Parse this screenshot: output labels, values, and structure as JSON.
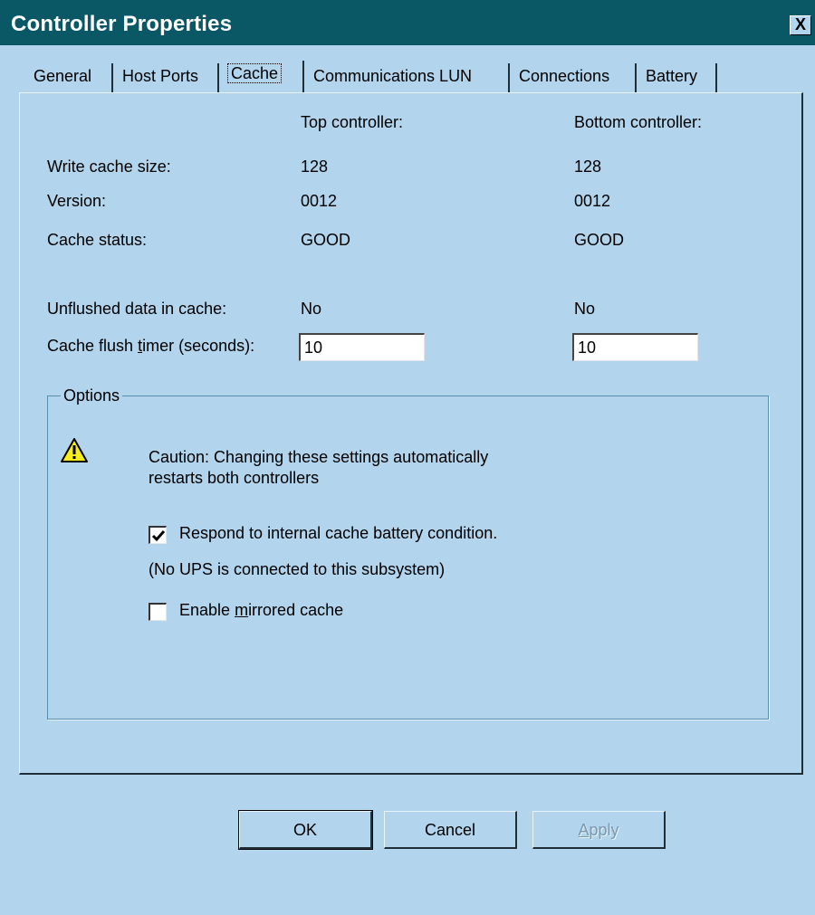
{
  "window": {
    "title": "Controller Properties",
    "close_label": "X"
  },
  "tabs": [
    {
      "label": "General",
      "active": false
    },
    {
      "label": "Host Ports",
      "active": false
    },
    {
      "label": "Cache",
      "active": true
    },
    {
      "label": "Communications LUN",
      "active": false
    },
    {
      "label": "Connections",
      "active": false
    },
    {
      "label": "Battery",
      "active": false
    }
  ],
  "cache": {
    "top_header": "Top controller:",
    "bottom_header": "Bottom controller:",
    "rows": [
      {
        "label": "Write cache size:",
        "top": "128",
        "bottom": "128"
      },
      {
        "label": "Version:",
        "top": "0012",
        "bottom": "0012"
      },
      {
        "label": "Cache status:",
        "top": "GOOD",
        "bottom": "GOOD"
      }
    ],
    "unflushed": {
      "label": "Unflushed data in cache:",
      "top": "No",
      "bottom": "No"
    },
    "flush_timer": {
      "label_before": "Cache flush ",
      "label_accel": "t",
      "label_after": "imer (seconds):",
      "top_value": "10",
      "bottom_value": "10"
    }
  },
  "options": {
    "group_label": "Options",
    "caution_line1": "Caution:  Changing these settings automatically",
    "caution_line2": "restarts both controllers",
    "warning_icon": "warning-triangle-icon",
    "respond_checkbox": {
      "label": "Respond to internal cache battery condition.",
      "checked": true
    },
    "ups_note": "(No UPS is connected to this subsystem)",
    "mirrored_checkbox": {
      "label_before": "Enable ",
      "label_accel": "m",
      "label_after": "irrored cache",
      "checked": false
    }
  },
  "buttons": {
    "ok": "OK",
    "cancel": "Cancel",
    "apply_accel": "A",
    "apply_rest": "pply"
  },
  "colors": {
    "background": "#b2d4ec",
    "titlebar": "#0a5866",
    "warning_yellow": "#f6ee1a"
  }
}
